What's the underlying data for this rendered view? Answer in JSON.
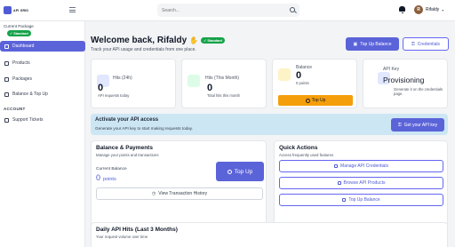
{
  "brand": {
    "logo_text": "API GRID"
  },
  "header": {
    "search_placeholder": "Search...",
    "user_initial": "R",
    "user_name": "Rifaldy"
  },
  "sidebar": {
    "package_label": "Current Package",
    "package_badge": "Standard",
    "items": [
      {
        "label": "Dashboard",
        "icon": "grid-icon",
        "active": true
      },
      {
        "label": "Products",
        "icon": "box-icon"
      },
      {
        "label": "Packages",
        "icon": "package-icon"
      },
      {
        "label": "Balance & Top Up",
        "icon": "wallet-icon"
      }
    ],
    "account_section": "ACCOUNT",
    "account_items": [
      {
        "label": "Support Tickets",
        "icon": "ticket-icon"
      }
    ]
  },
  "welcome": {
    "title": "Welcome back, Rifaldy",
    "badge": "Standard",
    "subtitle": "Track your API usage and credentials from one place.",
    "topup_balance_button": "Top Up Balance",
    "credentials_button": "Credentials"
  },
  "stats": {
    "hits_24h": {
      "label": "Hits (24h)",
      "value": "0",
      "sub": "API requests today"
    },
    "hits_month": {
      "label": "Hits (This Month)",
      "value": "0",
      "sub": "Total hits this month"
    },
    "balance": {
      "label": "Balance",
      "value": "0",
      "sub": "0 points",
      "button": "Top Up"
    },
    "api_key": {
      "label": "API Key",
      "value": "Provisioning",
      "sub": "Generate it on the credentials page."
    }
  },
  "banner": {
    "title": "Activate your API access",
    "text": "Generate your API key to start making requests today.",
    "button": "Get your API key"
  },
  "balance_card": {
    "title": "Balance & Payments",
    "subtitle": "Manage your points and transactions",
    "current_label": "Current Balance",
    "value": "0",
    "unit": "points",
    "topup_button": "Top Up",
    "history_button": "View Transaction History"
  },
  "quick_actions": {
    "title": "Quick Actions",
    "subtitle": "Access frequently used features",
    "buttons": [
      "Manage API Credentials",
      "Browse API Products",
      "Top Up Balance"
    ]
  },
  "daily_hits": {
    "title": "Daily API Hits (Last 3 Months)",
    "subtitle": "Your request volume over time"
  },
  "colors": {
    "primary": "#5b63d9",
    "success": "#16a34a",
    "warning": "#f59e0b",
    "banner_bg": "#cde6f4"
  }
}
